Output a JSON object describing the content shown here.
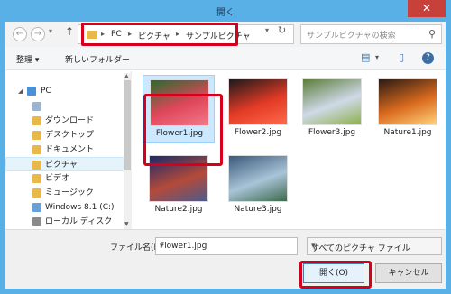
{
  "window": {
    "title": "開く",
    "close_glyph": "✕"
  },
  "address": {
    "back_glyph": "←",
    "forward_glyph": "→",
    "dropdown_glyph": "▾",
    "up_glyph": "↑",
    "crumbs": [
      "PC",
      "ピクチャ",
      "サンプルピクチャ"
    ],
    "separator": "▸",
    "refresh_glyph": "↻",
    "search_placeholder": "サンプルピクチャの検索",
    "search_glyph": "⚲"
  },
  "toolbar": {
    "organize": "整理 ▾",
    "new_folder": "新しいフォルダー",
    "view_glyph": "▤",
    "view_dd_glyph": "▾",
    "preview_glyph": "▯",
    "help_glyph": "?"
  },
  "sidebar": {
    "items": [
      {
        "label": "PC",
        "color": "#4a90d9"
      },
      {
        "label": "",
        "color": "#9ab4d4"
      },
      {
        "label": "ダウンロード",
        "color": "#e8b94a"
      },
      {
        "label": "デスクトップ",
        "color": "#e8b94a"
      },
      {
        "label": "ドキュメント",
        "color": "#e8b94a"
      },
      {
        "label": "ピクチャ",
        "color": "#e8b94a"
      },
      {
        "label": "ビデオ",
        "color": "#e8b94a"
      },
      {
        "label": "ミュージック",
        "color": "#e8b94a"
      },
      {
        "label": "Windows 8.1 (C:)",
        "color": "#6aa0d8"
      },
      {
        "label": "ローカル ディスク (D:)",
        "color": "#8a8a8a"
      }
    ],
    "selected_index": 5
  },
  "files": [
    {
      "name": "Flower1.jpg",
      "colors": [
        "#2b6b2e",
        "#e0465a",
        "#f07a8a"
      ]
    },
    {
      "name": "Flower2.jpg",
      "colors": [
        "#1a1a1a",
        "#e23a26",
        "#ff6a4a"
      ]
    },
    {
      "name": "Flower3.jpg",
      "colors": [
        "#5c7d3a",
        "#cfd9e8",
        "#8fb04c"
      ]
    },
    {
      "name": "Nature1.jpg",
      "colors": [
        "#2a1a14",
        "#d96a1e",
        "#ffd27a"
      ]
    },
    {
      "name": "Nature2.jpg",
      "colors": [
        "#1a2a6a",
        "#b44a3a",
        "#4c5a8a"
      ]
    },
    {
      "name": "Nature3.jpg",
      "colors": [
        "#3a5a7a",
        "#a8c4d8",
        "#3d6a4a"
      ]
    }
  ],
  "selected_file": 0,
  "footer": {
    "filename_label": "ファイル名(N):",
    "filename_value": "Flower1.jpg",
    "filetype_value": "すべてのピクチャ ファイル",
    "dd_glyph": "▾",
    "open_button": "開く(O)",
    "cancel_button": "キャンセル"
  },
  "colors": {
    "highlight": "#d6001c",
    "accent": "#59b0e6"
  }
}
